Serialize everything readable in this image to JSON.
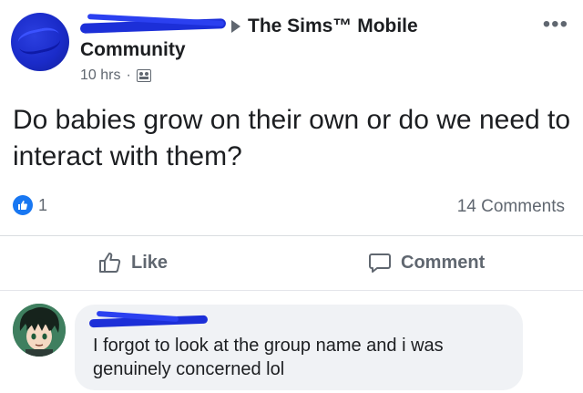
{
  "post": {
    "group_name": "The Sims™ Mobile",
    "community_label": "Community",
    "time": "10 hrs",
    "separator": "·",
    "text": "Do babies grow on their own or do we need to interact with them?",
    "reaction_count": "1",
    "comments_label": "14 Comments",
    "more_label": "•••"
  },
  "actions": {
    "like_label": "Like",
    "comment_label": "Comment"
  },
  "comment": {
    "text": "I forgot to look at the group name and i was genuinely concerned lol"
  },
  "colors": {
    "like_blue": "#1877f2",
    "redaction_blue": "#1c2fd8",
    "secondary_text": "#606770",
    "bubble_bg": "#f0f2f5"
  }
}
